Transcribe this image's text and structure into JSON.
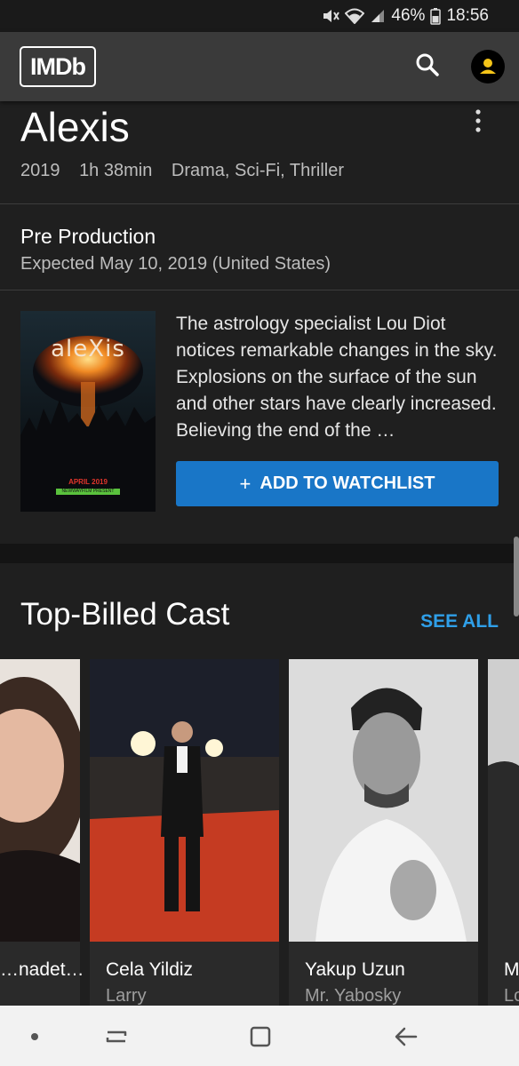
{
  "status_bar": {
    "battery": "46%",
    "time": "18:56"
  },
  "app_bar": {
    "logo": "IMDb",
    "search_icon": "search-icon",
    "account_icon": "account-icon"
  },
  "movie": {
    "title": "Alexis",
    "year": "2019",
    "runtime": "1h 38min",
    "genres": "Drama, Sci-Fi, Thriller",
    "status": "Pre Production",
    "expected": "Expected May 10, 2019 (United States)",
    "plot": "The astrology specialist Lou Diot notices remarkable changes in the sky. Explosions on the surface of the sun and other stars have clearly increased. Believing the end of the …",
    "watchlist_label": "ADD TO WATCHLIST",
    "poster": {
      "title": "aleXis",
      "date": "APRIL 2019",
      "tag": "NEWWAYFILM PRESENT"
    }
  },
  "cast_section": {
    "title": "Top-Billed Cast",
    "see_all": "SEE ALL",
    "members": [
      {
        "name": "…nadet…",
        "role": ""
      },
      {
        "name": "Cela Yildiz",
        "role": "Larry"
      },
      {
        "name": "Yakup Uzun",
        "role": "Mr. Yabosky"
      },
      {
        "name": "M",
        "role": "Lo"
      }
    ]
  },
  "colors": {
    "accent": "#1976c7",
    "link": "#2f9fe8",
    "background": "#1f1f1f",
    "appbar": "#3a3a3a",
    "account_icon": "#f5c518"
  }
}
